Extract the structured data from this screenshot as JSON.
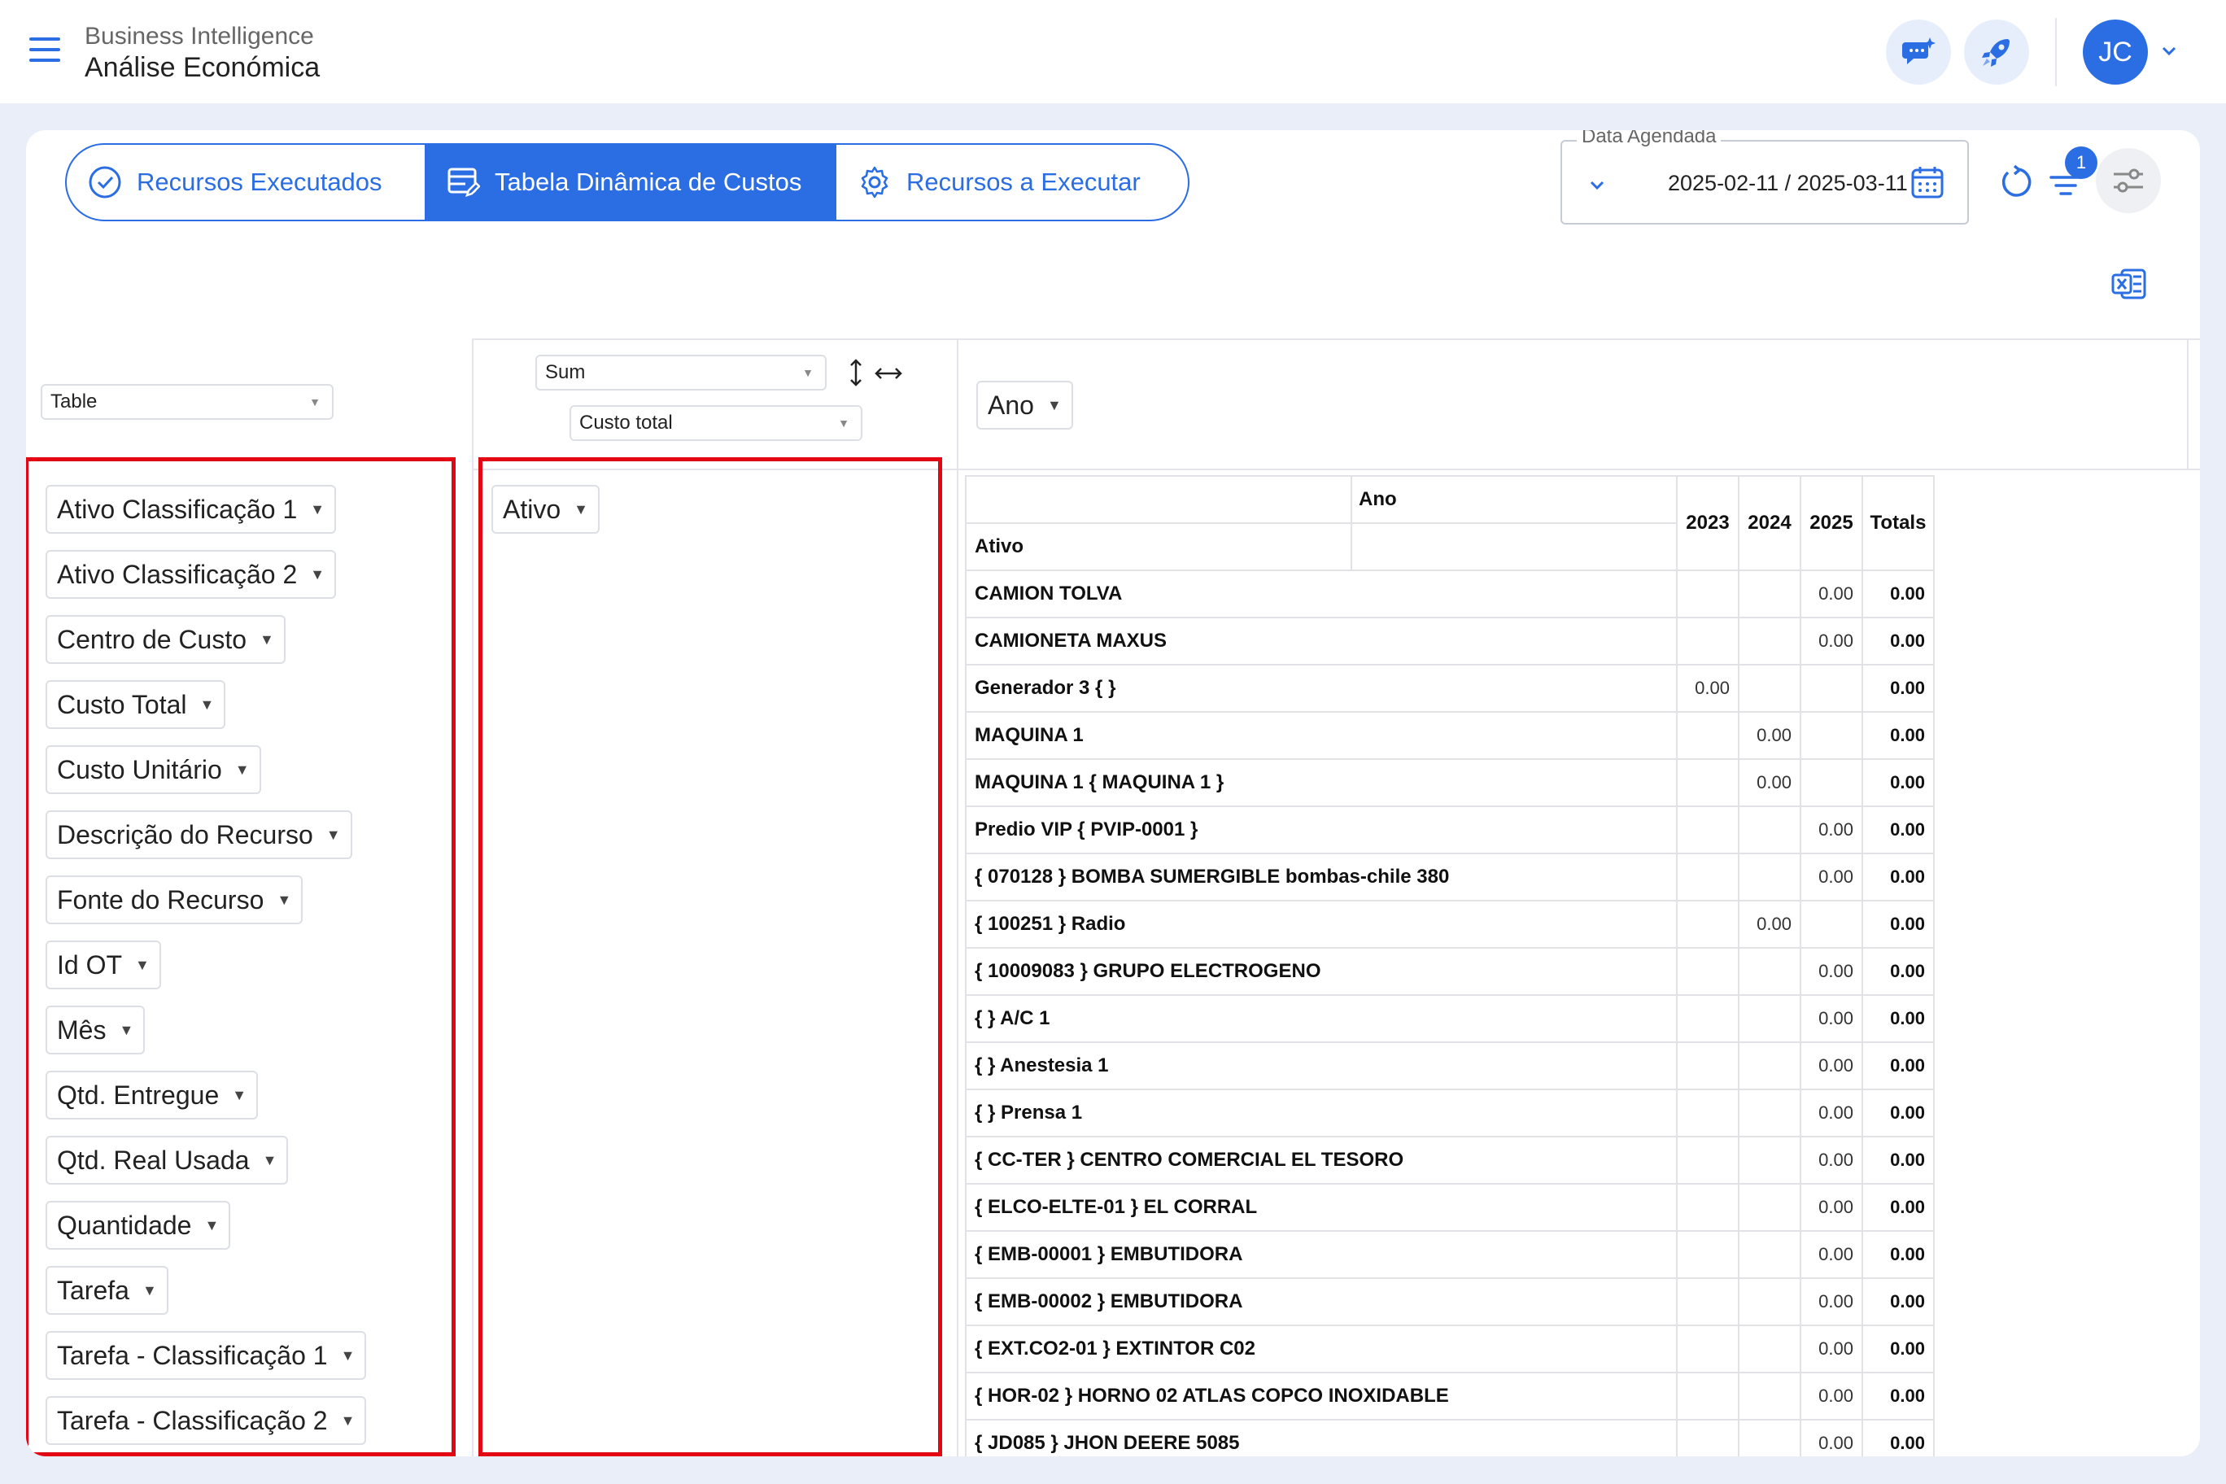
{
  "header": {
    "breadcrumb_parent": "Business Intelligence",
    "page_title": "Análise Económica",
    "user_initials": "JC"
  },
  "tabs": [
    {
      "label": "Recursos Executados"
    },
    {
      "label": "Tabela Dinâmica de Custos"
    },
    {
      "label": "Recursos a Executar"
    }
  ],
  "date_filter": {
    "label": "Data Agendada",
    "value": "2025-02-11 / 2025-03-11"
  },
  "filters_badge": "1",
  "pivot": {
    "renderer": "Table",
    "aggregator": "Sum",
    "aggregator_field": "Custo total",
    "column_field": "Ano",
    "row_field": "Ativo",
    "unused_fields": [
      "Ativo Classificação 1",
      "Ativo Classificação 2",
      "Centro de Custo",
      "Custo Total",
      "Custo Unitário",
      "Descrição do Recurso",
      "Fonte do Recurso",
      "Id OT",
      "Mês",
      "Qtd. Entregue",
      "Qtd. Real Usada",
      "Quantidade",
      "Tarefa",
      "Tarefa - Classificação 1",
      "Tarefa - Classificação 2"
    ],
    "table": {
      "col_header": "Ano",
      "row_header": "Ativo",
      "years": [
        "2023",
        "2024",
        "2025"
      ],
      "totals_label": "Totals",
      "rows": [
        {
          "label": "CAMION TOLVA",
          "v2023": "",
          "v2024": "",
          "v2025": "0.00",
          "total": "0.00"
        },
        {
          "label": "CAMIONETA MAXUS",
          "v2023": "",
          "v2024": "",
          "v2025": "0.00",
          "total": "0.00"
        },
        {
          "label": "Generador 3 { }",
          "v2023": "0.00",
          "v2024": "",
          "v2025": "",
          "total": "0.00"
        },
        {
          "label": "MAQUINA 1",
          "v2023": "",
          "v2024": "0.00",
          "v2025": "",
          "total": "0.00"
        },
        {
          "label": "MAQUINA 1 { MAQUINA 1 }",
          "v2023": "",
          "v2024": "0.00",
          "v2025": "",
          "total": "0.00"
        },
        {
          "label": "Predio VIP { PVIP-0001 }",
          "v2023": "",
          "v2024": "",
          "v2025": "0.00",
          "total": "0.00"
        },
        {
          "label": "{ 070128 } BOMBA SUMERGIBLE bombas-chile 380",
          "v2023": "",
          "v2024": "",
          "v2025": "0.00",
          "total": "0.00"
        },
        {
          "label": "{ 100251 } Radio",
          "v2023": "",
          "v2024": "0.00",
          "v2025": "",
          "total": "0.00"
        },
        {
          "label": "{ 10009083 } GRUPO ELECTROGENO",
          "v2023": "",
          "v2024": "",
          "v2025": "0.00",
          "total": "0.00"
        },
        {
          "label": "{ } A/C 1",
          "v2023": "",
          "v2024": "",
          "v2025": "0.00",
          "total": "0.00"
        },
        {
          "label": "{ } Anestesia 1",
          "v2023": "",
          "v2024": "",
          "v2025": "0.00",
          "total": "0.00"
        },
        {
          "label": "{ } Prensa 1",
          "v2023": "",
          "v2024": "",
          "v2025": "0.00",
          "total": "0.00"
        },
        {
          "label": "{ CC-TER } CENTRO COMERCIAL EL TESORO",
          "v2023": "",
          "v2024": "",
          "v2025": "0.00",
          "total": "0.00"
        },
        {
          "label": "{ ELCO-ELTE-01 } EL CORRAL",
          "v2023": "",
          "v2024": "",
          "v2025": "0.00",
          "total": "0.00"
        },
        {
          "label": "{ EMB-00001 } EMBUTIDORA",
          "v2023": "",
          "v2024": "",
          "v2025": "0.00",
          "total": "0.00"
        },
        {
          "label": "{ EMB-00002 } EMBUTIDORA",
          "v2023": "",
          "v2024": "",
          "v2025": "0.00",
          "total": "0.00"
        },
        {
          "label": "{ EXT.CO2-01 } EXTINTOR C02",
          "v2023": "",
          "v2024": "",
          "v2025": "0.00",
          "total": "0.00"
        },
        {
          "label": "{ HOR-02 } HORNO 02 ATLAS COPCO INOXIDABLE",
          "v2023": "",
          "v2024": "",
          "v2025": "0.00",
          "total": "0.00"
        },
        {
          "label": "{ JD085 } JHON DEERE 5085",
          "v2023": "",
          "v2024": "",
          "v2025": "0.00",
          "total": "0.00"
        }
      ]
    }
  },
  "colors": {
    "accent": "#2b6de3",
    "highlight_box": "#e30613",
    "background": "#e9eef9"
  }
}
